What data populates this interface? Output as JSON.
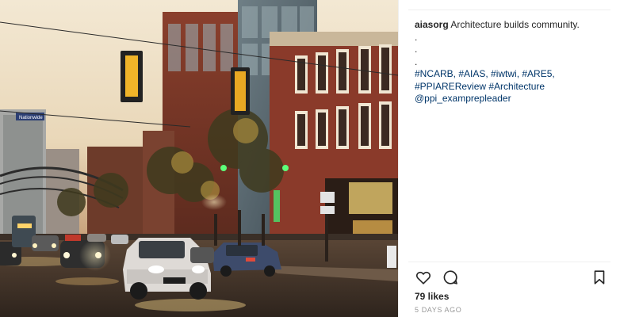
{
  "post": {
    "username": "aiasorg",
    "caption_text": "Architecture builds community.",
    "caption_lines": [
      ".",
      ".",
      "."
    ],
    "hashtags_line1": "#NCARB, #AIAS, #iwtwi, #ARE5,",
    "hashtags_line2": "#PPIAREReview #Architecture",
    "mention": "@ppi_examprepleader",
    "likes": "79 likes",
    "timestamp": "5 DAYS AGO"
  },
  "photo": {
    "description_icon": "street-photo",
    "sign_text": "Nationwide"
  },
  "icons": {
    "like": "heart-icon",
    "comment": "comment-icon",
    "save": "bookmark-icon"
  }
}
